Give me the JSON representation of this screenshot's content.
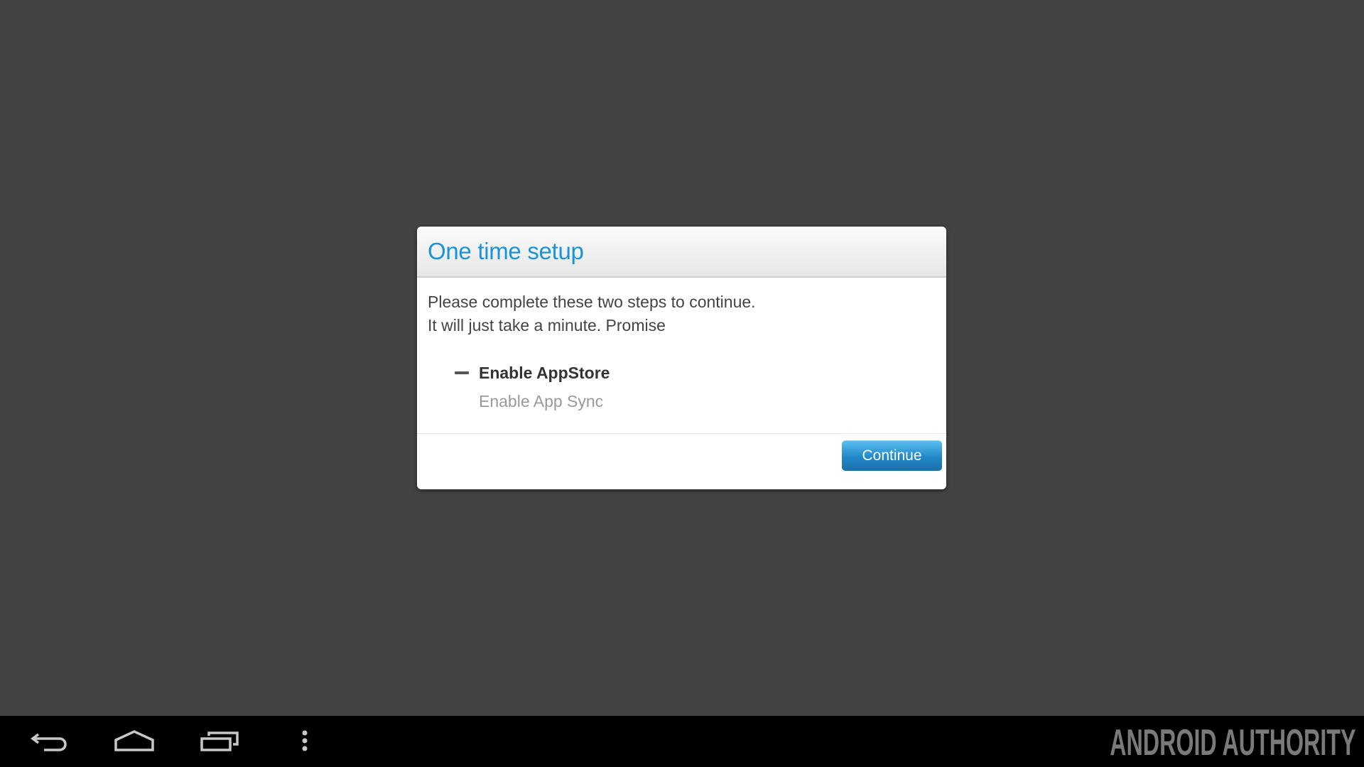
{
  "dialog": {
    "title": "One time setup",
    "message_line1": "Please complete these two steps to continue.",
    "message_line2": "It will just take a minute. Promise",
    "steps": [
      {
        "label": "Enable AppStore",
        "state": "active",
        "icon": "dash-icon"
      },
      {
        "label": "Enable App Sync",
        "state": "pending"
      }
    ],
    "continue_label": "Continue",
    "title_color": "#1a93d8",
    "button_color": "#2288c8"
  },
  "navbar": {
    "buttons": [
      {
        "name": "back",
        "icon": "back-arrow-icon"
      },
      {
        "name": "home",
        "icon": "home-icon"
      },
      {
        "name": "recents",
        "icon": "recent-apps-icon"
      },
      {
        "name": "menu",
        "icon": "overflow-menu-icon"
      }
    ]
  },
  "watermark": "ANDROID AUTHORITY"
}
